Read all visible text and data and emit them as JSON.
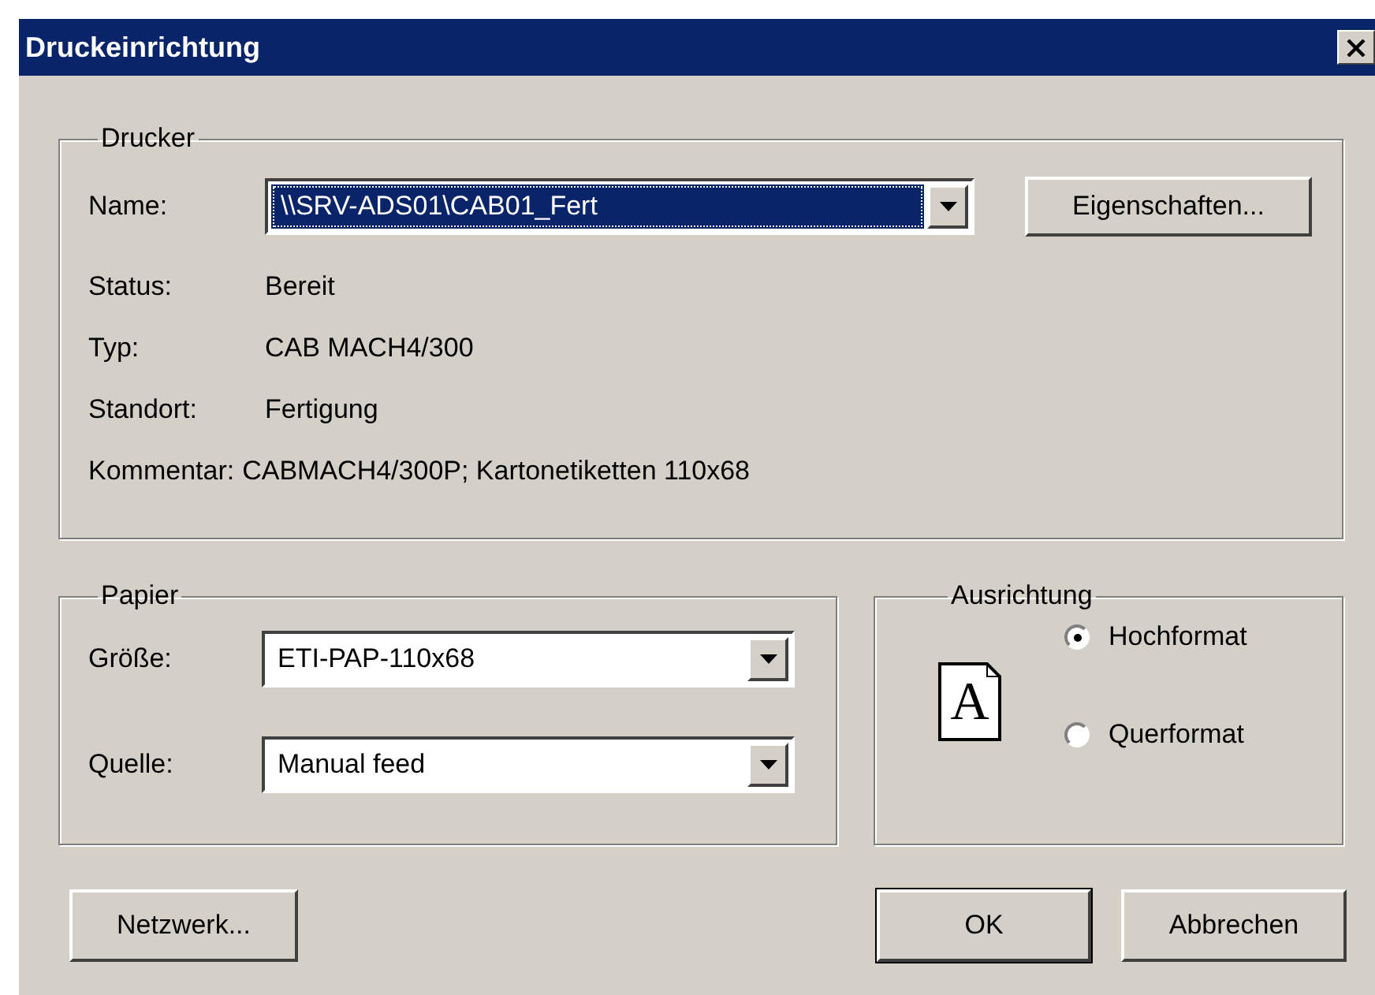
{
  "window": {
    "title": "Druckeinrichtung"
  },
  "printer": {
    "group_title": "Drucker",
    "name_label": "Name:",
    "name_value": "\\\\SRV-ADS01\\CAB01_Fert",
    "name_selected": true,
    "properties_button": "Eigenschaften...",
    "details": [
      {
        "label": "Status:",
        "value": "Bereit"
      },
      {
        "label": "Typ:",
        "value": "CAB MACH4/300"
      },
      {
        "label": "Standort:",
        "value": "Fertigung"
      },
      {
        "label": "Kommentar:",
        "value": "CABMACH4/300P; Kartonetiketten 110x68"
      }
    ]
  },
  "paper": {
    "group_title": "Papier",
    "fields": [
      {
        "label": "Größe:",
        "value": "ETI-PAP-110x68"
      },
      {
        "label": "Quelle:",
        "value": "Manual feed"
      }
    ]
  },
  "orientation": {
    "group_title": "Ausrichtung",
    "preview_letter": "A",
    "options": [
      {
        "label": "Hochformat",
        "selected": true
      },
      {
        "label": "Querformat",
        "selected": false
      }
    ]
  },
  "network_button": "Netzwerk...",
  "buttons": [
    {
      "label": "OK",
      "default": true
    },
    {
      "label": "Abbrechen",
      "default": false
    }
  ]
}
